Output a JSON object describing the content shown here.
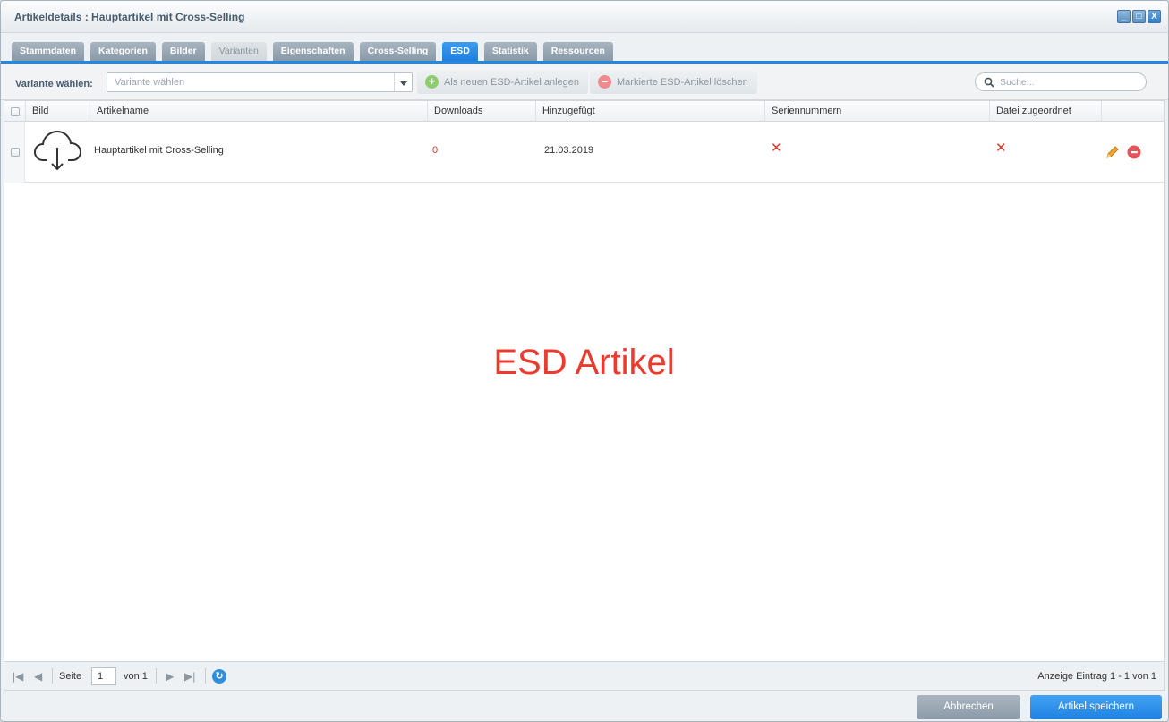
{
  "window": {
    "title": "Artikeldetails : Hauptartikel mit Cross-Selling",
    "controls": {
      "minimize": "_",
      "maximize": "□",
      "close": "X"
    }
  },
  "tabs": [
    {
      "label": "Stammdaten",
      "state": "normal"
    },
    {
      "label": "Kategorien",
      "state": "normal"
    },
    {
      "label": "Bilder",
      "state": "normal"
    },
    {
      "label": "Varianten",
      "state": "disabled"
    },
    {
      "label": "Eigenschaften",
      "state": "normal"
    },
    {
      "label": "Cross-Selling",
      "state": "normal"
    },
    {
      "label": "ESD",
      "state": "active"
    },
    {
      "label": "Statistik",
      "state": "normal"
    },
    {
      "label": "Ressourcen",
      "state": "normal"
    }
  ],
  "toolbar": {
    "variant_label": "Variante wählen:",
    "variant_placeholder": "Variante wählen",
    "add_button": "Als neuen ESD-Artikel anlegen",
    "delete_button": "Markierte ESD-Artikel löschen",
    "search_placeholder": "Suche..."
  },
  "grid": {
    "columns": [
      "Bild",
      "Artikelname",
      "Downloads",
      "Hinzugefügt",
      "Seriennummern",
      "Datei zugeordnet"
    ],
    "rows": [
      {
        "image_icon": "cloud-download-icon",
        "name": "Hauptartikel mit Cross-Selling",
        "downloads": "0",
        "added": "21.03.2019",
        "serial_numbers": "✕",
        "file_assigned": "✕"
      }
    ]
  },
  "watermark": "ESD Artikel",
  "pager": {
    "page_label": "Seite",
    "page_value": "1",
    "of_label": "von 1",
    "info": "Anzeige Eintrag 1 - 1 von 1"
  },
  "footer": {
    "cancel": "Abbrechen",
    "save": "Artikel speichern"
  },
  "colors": {
    "accent": "#2188e3",
    "danger": "#e0362e",
    "tab": "#8999a7"
  }
}
